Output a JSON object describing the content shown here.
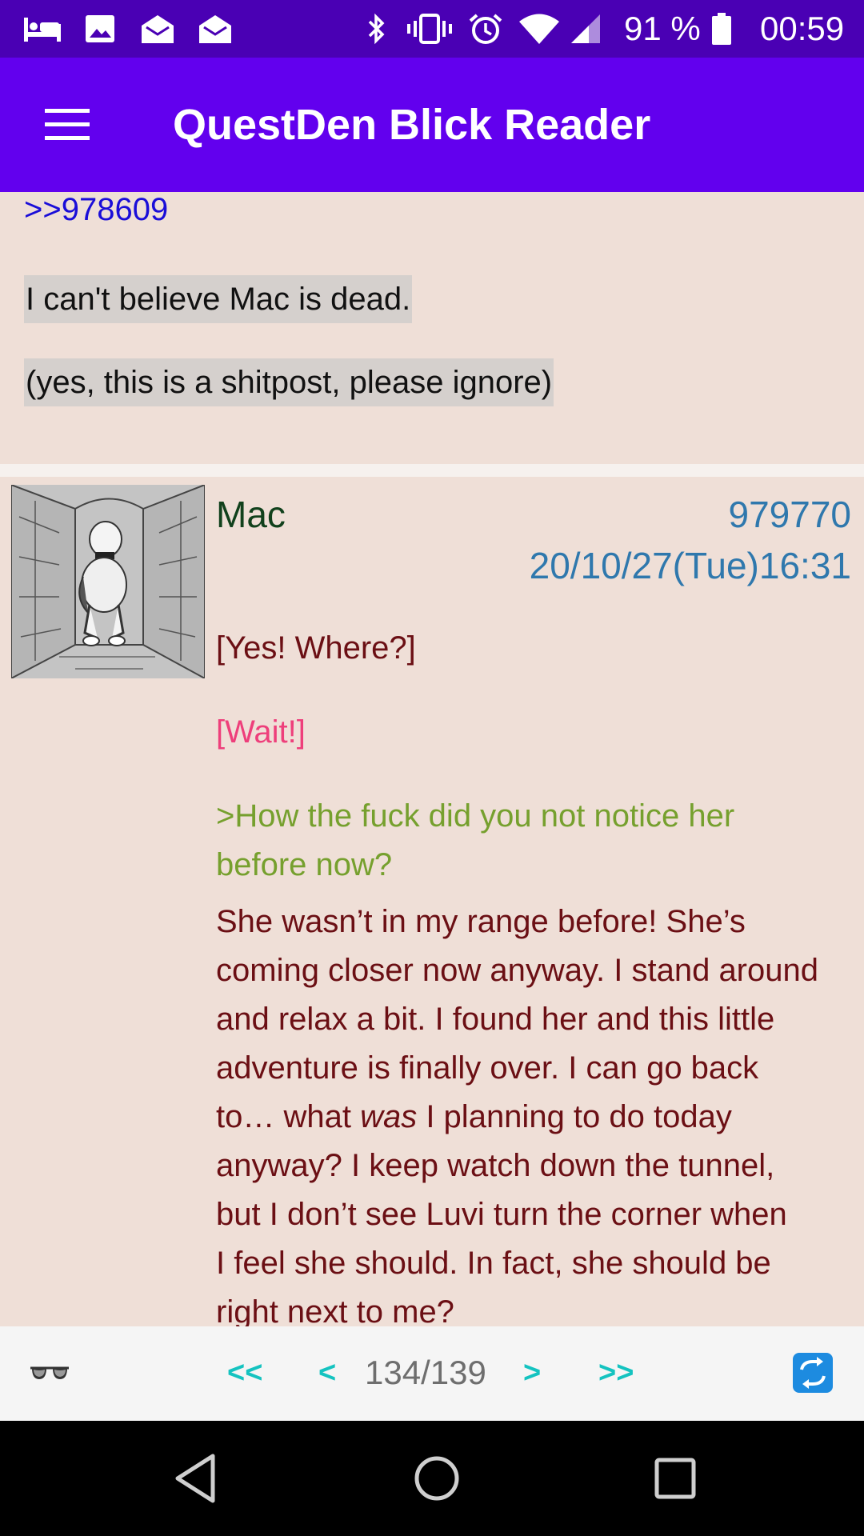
{
  "status_bar": {
    "battery": "91 %",
    "time": "00:59",
    "icons": [
      "bed-icon",
      "image-icon",
      "mail-open-icon",
      "mail-open-icon",
      "bluetooth-icon",
      "vibrate-icon",
      "alarm-icon",
      "wifi-icon",
      "signal-icon",
      "battery-icon"
    ]
  },
  "app_bar": {
    "title": "QuestDen Blick Reader"
  },
  "previous_post": {
    "reply_link": ">>978609",
    "lines": [
      "I can't believe Mac is dead.",
      "(yes, this is a shitpost, please ignore)"
    ]
  },
  "post": {
    "name": "Mac",
    "number": "979770",
    "date": "20/10/27(Tue)16:31",
    "body": {
      "line1": "[Yes! Where?]",
      "line2": "[Wait!]",
      "quote": [
        ">How the fuck did you not notice her",
        "before now?"
      ],
      "text": [
        "She wasn’t in my range before! She’s",
        "coming closer now anyway. I stand around",
        "and relax a bit. I found her and this little",
        "adventure is finally over. I can go back"
      ],
      "text_italic": {
        "before": "to… what ",
        "italic": "was",
        "after": " I planning to do today"
      },
      "text_rest": [
        "anyway? I keep watch down the tunnel,",
        "but I don’t see Luvi turn the corner when",
        "I feel she should. In fact, she should be",
        "right next to me?"
      ]
    }
  },
  "bottom_nav": {
    "first": "<<",
    "prev": "<",
    "page": "134/139",
    "next": ">",
    "last": ">>"
  },
  "colors": {
    "status_bar": "#4a00b4",
    "app_bar": "#6200ee",
    "post_background": "#efdfd7",
    "post_text": "#6b0f14",
    "pink_text": "#ee3f7b",
    "green_quote": "#76a02e",
    "link": "#1a0dd8",
    "meta_blue": "#2f78ad",
    "nav_teal": "#14c3c0"
  }
}
